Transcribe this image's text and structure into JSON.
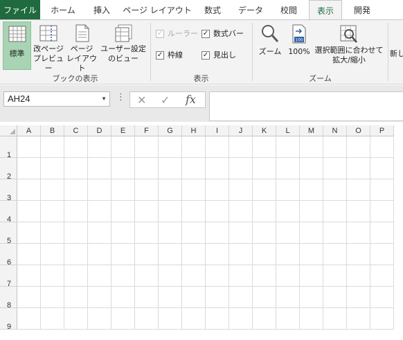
{
  "tabs": [
    {
      "label": "ファイル",
      "key": "file"
    },
    {
      "label": "ホーム",
      "key": "home"
    },
    {
      "label": "挿入",
      "key": "insert"
    },
    {
      "label": "ページ レイアウト",
      "key": "page-layout"
    },
    {
      "label": "数式",
      "key": "formulas"
    },
    {
      "label": "データ",
      "key": "data"
    },
    {
      "label": "校閲",
      "key": "review"
    },
    {
      "label": "表示",
      "key": "view"
    },
    {
      "label": "開発",
      "key": "developer"
    }
  ],
  "active_tab": "表示",
  "ribbon": {
    "workbook_views": {
      "group_label": "ブックの表示",
      "normal": "標準",
      "page_break": "改ページ\nプレビュー",
      "page_layout": "ページ\nレイアウト",
      "custom_views": "ユーザー設定\nのビュー"
    },
    "show": {
      "group_label": "表示",
      "ruler": {
        "label": "ルーラー",
        "checked": true,
        "enabled": false
      },
      "formula_bar": {
        "label": "数式バー",
        "checked": true,
        "enabled": true
      },
      "gridlines": {
        "label": "枠線",
        "checked": true,
        "enabled": true
      },
      "headings": {
        "label": "見出し",
        "checked": true,
        "enabled": true
      }
    },
    "zoom": {
      "group_label": "ズーム",
      "zoom": "ズーム",
      "zoom_100": "100%",
      "zoom_to_selection": "選択範囲に合わせて\n拡大/縮小",
      "icon_100_text": "100"
    },
    "window": {
      "new_window_partial": "新し"
    }
  },
  "formula_bar": {
    "name_box_value": "AH24",
    "dropdown_glyph": "▼",
    "dots": "⋮",
    "cancel_glyph": "✕",
    "enter_glyph": "✓",
    "fx_label": "fx",
    "formula_value": ""
  },
  "sheet": {
    "columns": [
      "A",
      "B",
      "C",
      "D",
      "E",
      "F",
      "G",
      "H",
      "I",
      "J",
      "K",
      "L",
      "M",
      "N",
      "O",
      "P"
    ],
    "rows": [
      "1",
      "2",
      "3",
      "4",
      "5",
      "6",
      "7",
      "8",
      "9"
    ]
  },
  "colors": {
    "file_tab": "#1f6a3e",
    "active_tab_text": "#1f6a3e",
    "selected_view": "#a9d4b3",
    "ribbon_bg": "#f3f3f3"
  }
}
